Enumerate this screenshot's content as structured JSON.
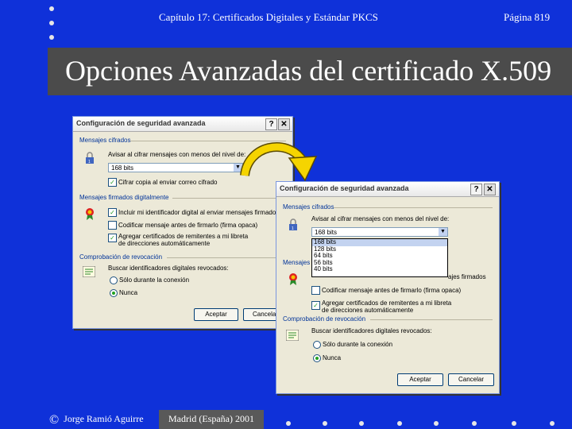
{
  "slide": {
    "header_text": "Capítulo 17: Certificados Digitales y Estándar PKCS",
    "page_number": "Página 819",
    "title": "Opciones Avanzadas del certificado X.509",
    "footer_author": "Jorge Ramió Aguirre",
    "footer_place": "Madrid (España) 2001",
    "copyright_symbol": "©"
  },
  "dialog1": {
    "title": "Configuración de seguridad avanzada",
    "help_button": "?",
    "close_button": "✕",
    "sec_encrypted": "Mensajes cifrados",
    "warn_label": "Avisar al cifrar mensajes con menos del nivel de:",
    "strength_value": "168 bits",
    "always_encrypt": "Cifrar copia al enviar correo cifrado",
    "sec_signed": "Mensajes firmados digitalmente",
    "include_id": "Incluir mi identificador digital al enviar mensajes firmados",
    "encode_before": "Codificar mensaje antes de firmarlo (firma opaca)",
    "add_certs": "Agregar certificados de remitentes a mi libreta de direcciones automáticamente",
    "sec_revocation": "Comprobación de revocación",
    "check_revoked": "Buscar identificadores digitales revocados:",
    "only_online": "Sólo durante la conexión",
    "never": "Nunca",
    "ok": "Aceptar",
    "cancel": "Cancelar"
  },
  "dialog2": {
    "title": "Configuración de seguridad avanzada",
    "help_button": "?",
    "close_button": "✕",
    "sec_encrypted": "Mensajes cifrados",
    "warn_label": "Avisar al cifrar mensajes con menos del nivel de:",
    "strength_value": "168 bits",
    "options": [
      "168 bits",
      "128 bits",
      "64 bits",
      "56 bits",
      "40 bits"
    ],
    "sec_signed_partial": "Mensajes",
    "signed_tail": "ajes firmados",
    "encode_before": "Codificar mensaje antes de firmarlo (firma opaca)",
    "add_certs": "Agregar certificados de remitentes a mi libreta de direcciones automáticamente",
    "sec_revocation": "Comprobación de revocación",
    "check_revoked": "Buscar identificadores digitales revocados:",
    "only_online": "Sólo durante la conexión",
    "never": "Nunca",
    "ok": "Aceptar",
    "cancel": "Cancelar"
  },
  "colors": {
    "background": "#0f31d9",
    "title_bar": "#4b4b4b",
    "dialog_face": "#ece9d8",
    "accent_arrow": "#f5d400"
  }
}
